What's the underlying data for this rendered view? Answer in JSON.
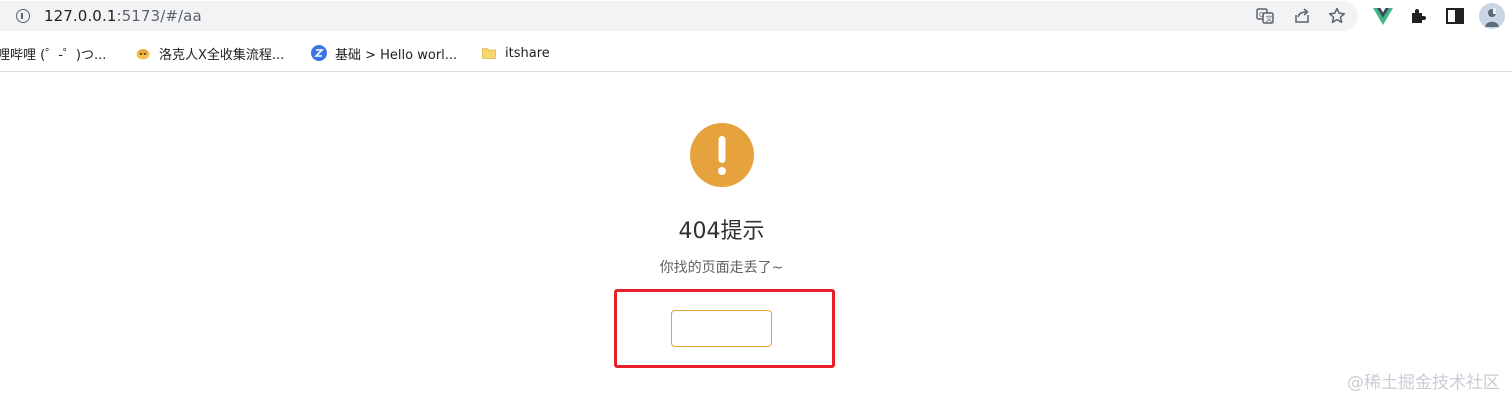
{
  "browser": {
    "url_host": "127.0.0.1",
    "url_path": ":5173/#/aa",
    "icons": [
      "info-icon",
      "translate-icon",
      "share-icon",
      "star-icon",
      "vue-devtools-icon",
      "extensions-icon",
      "side-panel-icon",
      "avatar"
    ]
  },
  "bookmarks": [
    {
      "label": "哩哔哩 (゜-゜)つ...",
      "icon": "bilibili-icon"
    },
    {
      "label": "洛克人X全收集流程...",
      "icon": "bird-icon"
    },
    {
      "label": "基础 > Hello worl...",
      "icon": "z-icon"
    },
    {
      "label": "itshare",
      "icon": "folder-icon"
    }
  ],
  "page": {
    "icon": "warning-icon",
    "icon_color": "#e6a23c",
    "title": "404提示",
    "subtitle": "你找的页面走丢了~",
    "button_label": "",
    "highlight_color": "#e8202a"
  },
  "watermark": "@稀土掘金技术社区"
}
